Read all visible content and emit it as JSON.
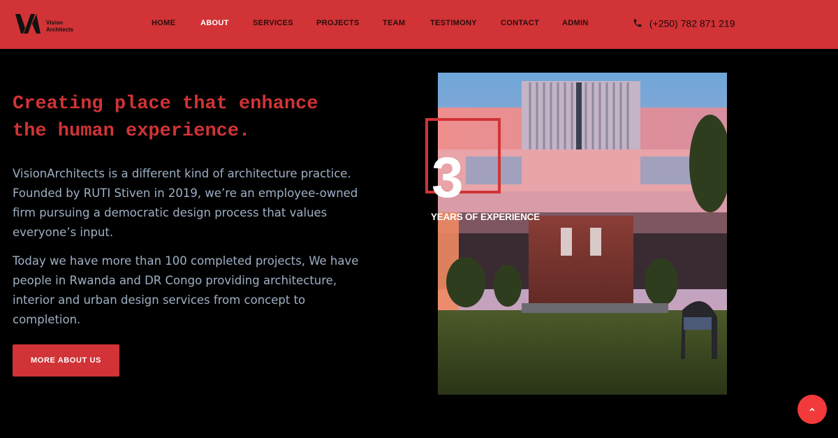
{
  "brand": {
    "line1": "Vision",
    "line2": "Architects"
  },
  "nav": {
    "items": [
      "HOME",
      "ABOUT",
      "SERVICES",
      "PROJECTS",
      "TEAM",
      "TESTIMONY",
      "CONTACT",
      "ADMIN"
    ],
    "active": "ABOUT"
  },
  "contact": {
    "phone": "(+250) 782 871 219",
    "icon": "phone-icon"
  },
  "hero": {
    "headline_line1": "Creating place that enhance",
    "headline_line2": "the human experience.",
    "paragraph1": "VisionArchitects is a different kind of architecture practice. Founded by RUTI Stiven in 2019, we’re an employee-owned firm pursuing a democratic design process that values everyone’s input.",
    "paragraph2": "Today we have more than 100 completed projects, We have people in Rwanda and DR Congo providing architecture, interior and urban design services from concept to completion.",
    "cta_label": "MORE ABOUT US"
  },
  "experience": {
    "number": "3",
    "label": "YEARS OF EXPERIENCE"
  },
  "back_to_top": {
    "icon": "chevron-up-icon"
  },
  "colors": {
    "accent": "#d13336",
    "background": "#000000",
    "body_text": "#9fb0c5",
    "button_float": "#f23a3a"
  }
}
